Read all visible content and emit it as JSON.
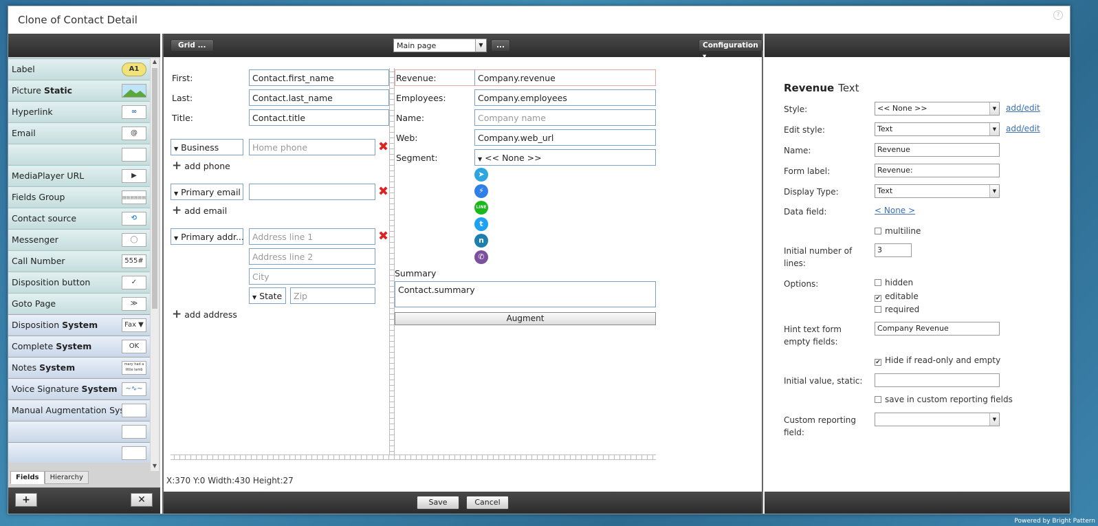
{
  "window": {
    "title": "Clone of Contact Detail"
  },
  "palette": {
    "items": [
      {
        "label": "Label",
        "bold": "",
        "icon": "A1",
        "type": "normal"
      },
      {
        "label": "Picture ",
        "bold": "Static",
        "icon": "picture-icon",
        "type": "normal"
      },
      {
        "label": "Hyperlink",
        "bold": "",
        "icon": "link-icon",
        "type": "normal"
      },
      {
        "label": "Email",
        "bold": "",
        "icon": "@",
        "type": "normal"
      },
      {
        "label": "",
        "bold": "",
        "icon": "",
        "type": "normal"
      },
      {
        "label": "MediaPlayer URL",
        "bold": "",
        "icon": "▶",
        "type": "normal"
      },
      {
        "label": "Fields Group",
        "bold": "",
        "icon": "fields-group-icon",
        "type": "normal"
      },
      {
        "label": "Contact source",
        "bold": "",
        "icon": "contact-source-icon",
        "type": "normal"
      },
      {
        "label": "Messenger",
        "bold": "",
        "icon": "speech-bubble-icon",
        "type": "normal"
      },
      {
        "label": "Call Number",
        "bold": "",
        "icon": "555#",
        "type": "normal"
      },
      {
        "label": "Disposition button",
        "bold": "",
        "icon": "✓",
        "type": "normal"
      },
      {
        "label": "Goto Page",
        "bold": "",
        "icon": "≫",
        "type": "normal"
      },
      {
        "label": "Disposition ",
        "bold": "System",
        "icon": "Fax ▼",
        "type": "sys"
      },
      {
        "label": "Complete ",
        "bold": "System",
        "icon": "OK",
        "type": "sys"
      },
      {
        "label": "Notes ",
        "bold": "System",
        "icon": "mary had a little lamb",
        "type": "sys"
      },
      {
        "label": "Voice Signature ",
        "bold": "System",
        "icon": "waveform-icon",
        "type": "sys"
      },
      {
        "label": "Manual Augmentation Sys...",
        "bold": "",
        "icon": "",
        "type": "sys"
      },
      {
        "label": "",
        "bold": "",
        "icon": "",
        "type": "sys"
      },
      {
        "label": "",
        "bold": "",
        "icon": "",
        "type": "sys"
      }
    ],
    "tabs": [
      "Fields",
      "Hierarchy"
    ],
    "add_btn": "+",
    "remove_btn": "✕"
  },
  "toolbar": {
    "grid": "Grid ...",
    "page": "Main page",
    "more": "...",
    "config": "Configuration"
  },
  "form": {
    "first_label": "First:",
    "first_val": "Contact.first_name",
    "last_label": "Last:",
    "last_val": "Contact.last_name",
    "title_label": "Title:",
    "title_val": "Contact.title",
    "phone_type": "Business",
    "phone_ph": "Home phone",
    "add_phone": "add phone",
    "email_type": "Primary email",
    "email_val": "",
    "add_email": "add email",
    "addr_type": "Primary addr...",
    "addr1_ph": "Address line 1",
    "addr2_ph": "Address line 2",
    "city_ph": "City",
    "state": "State",
    "zip_ph": "Zip",
    "add_address": "add address",
    "revenue_label": "Revenue:",
    "revenue_val": "Company.revenue",
    "employees_label": "Employees:",
    "employees_val": "Company.employees",
    "name_label": "Name:",
    "name_ph": "Company name",
    "web_label": "Web:",
    "web_val": "Company.web_url",
    "segment_label": "Segment:",
    "segment_val": "<< None >>",
    "summary_label": "Summary",
    "summary_val": "Contact.summary",
    "augment": "Augment"
  },
  "messengers": [
    {
      "name": "telegram-icon",
      "glyph": "➤",
      "color": "#2ca5e0"
    },
    {
      "name": "messenger-icon",
      "glyph": "⚡",
      "color": "#2f7fe6"
    },
    {
      "name": "line-icon",
      "glyph": "LINE",
      "color": "#19b91a"
    },
    {
      "name": "twitter-icon",
      "glyph": "t",
      "color": "#1da1f2"
    },
    {
      "name": "nextiva-icon",
      "glyph": "n",
      "color": "#1d7fb0"
    },
    {
      "name": "viber-icon",
      "glyph": "✆",
      "color": "#7b519d"
    }
  ],
  "status": {
    "coords": "X:370 Y:0 Width:430 Height:27"
  },
  "footer": {
    "save": "Save",
    "cancel": "Cancel"
  },
  "props": {
    "title": "Revenue",
    "subtitle": "Text",
    "style_label": "Style:",
    "style_val": "<< None >>",
    "add_edit": "add/edit",
    "edit_style_label": "Edit style:",
    "edit_style_val": "Text",
    "name_label": "Name:",
    "name_val": "Revenue",
    "form_label_label": "Form label:",
    "form_label_val": "Revenue:",
    "display_type_label": "Display Type:",
    "display_type_val": "Text",
    "data_field_label": "Data field:",
    "data_field_val": "< None >",
    "multiline": "multiline",
    "initial_lines_label": "Initial number of lines:",
    "initial_lines_val": "3",
    "options_label": "Options:",
    "hidden": "hidden",
    "editable": "editable",
    "required": "required",
    "hint_label": "Hint text form empty fields:",
    "hint_val": "Company Revenue",
    "hide_ro": "Hide if read-only and empty",
    "initial_static_label": "Initial value, static:",
    "initial_static_val": "",
    "save_custom": "save in custom reporting fields",
    "custom_field_label": "Custom reporting field:",
    "custom_field_val": ""
  },
  "powered": "Powered by Bright Pattern"
}
